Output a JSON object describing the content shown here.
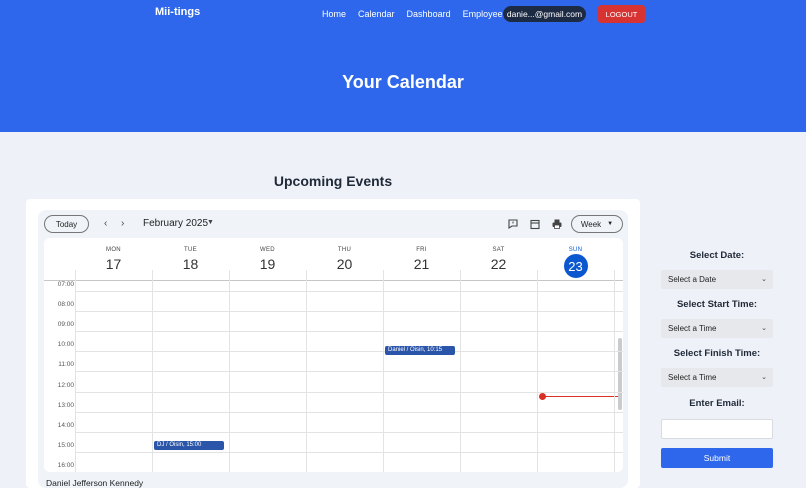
{
  "header": {
    "brand": "Mii-tings",
    "nav": [
      "Home",
      "Calendar",
      "Dashboard",
      "Employees"
    ],
    "user_email": "danie...@gmail.com",
    "logout_label": "LOGOUT",
    "title": "Your Calendar",
    "bg_color": "#2e67eb"
  },
  "section_title": "Upcoming Events",
  "calendar": {
    "today_label": "Today",
    "month_label": "February 2025",
    "view_label": "Week",
    "days": [
      {
        "name": "MON",
        "date": "17"
      },
      {
        "name": "TUE",
        "date": "18"
      },
      {
        "name": "WED",
        "date": "19"
      },
      {
        "name": "THU",
        "date": "20"
      },
      {
        "name": "FRI",
        "date": "21"
      },
      {
        "name": "SAT",
        "date": "22"
      },
      {
        "name": "SUN",
        "date": "23"
      }
    ],
    "times": [
      "07:00",
      "08:00",
      "09:00",
      "10:00",
      "11:00",
      "12:00",
      "13:00",
      "14:00",
      "15:00",
      "16:00"
    ],
    "events": [
      {
        "title": "Daniel / Oisin, 10:15",
        "day": "FRI"
      },
      {
        "title": "DJ / Oisin, 15:00",
        "day": "TUE"
      }
    ]
  },
  "footer_name": "Daniel Jefferson Kennedy",
  "form": {
    "date_label": "Select Date:",
    "date_placeholder": "Select a Date",
    "start_label": "Select Start Time:",
    "start_placeholder": "Select a Time",
    "finish_label": "Select Finish Time:",
    "finish_placeholder": "Select a Time",
    "email_label": "Enter Email:",
    "submit_label": "Submit"
  }
}
